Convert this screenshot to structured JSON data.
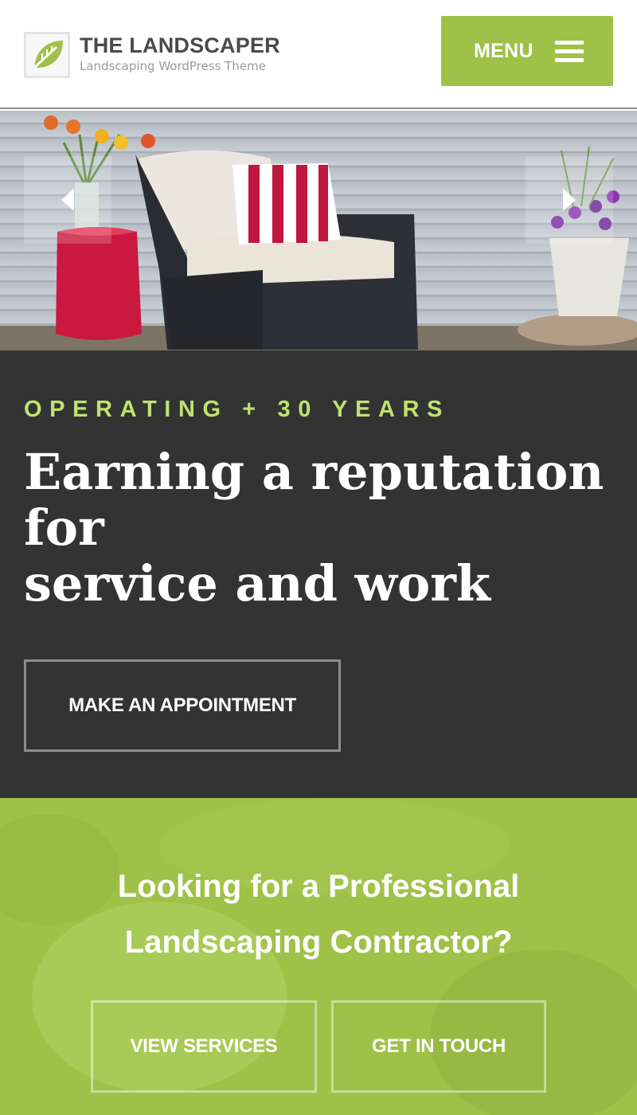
{
  "header": {
    "logo_title": "THE LANDSCAPER",
    "logo_subtitle": "Landscaping WordPress Theme",
    "menu_label": "MENU",
    "accent_color": "#9fc148"
  },
  "hero": {
    "prev_icon": "chevron-left-icon",
    "next_icon": "chevron-right-icon"
  },
  "intro": {
    "eyebrow": "OPERATING + 30 YEARS",
    "headline_line1": "Earning a reputation",
    "headline_line2": "for",
    "headline_line3": "service and work",
    "appointment_button": "MAKE AN APPOINTMENT",
    "background_color": "#333333",
    "eyebrow_color": "#c3e06e"
  },
  "cta": {
    "title_line1": "Looking for a Professional",
    "title_line2": "Landscaping Contractor?",
    "services_button": "VIEW SERVICES",
    "contact_button": "GET IN TOUCH"
  }
}
